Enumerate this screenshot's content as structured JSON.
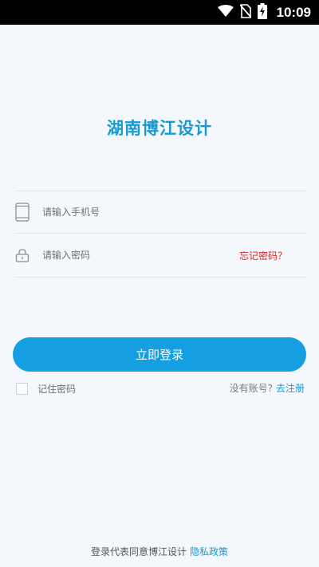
{
  "status_bar": {
    "time": "10:09",
    "icons": [
      "wifi-icon",
      "no-sim-icon",
      "battery-charging-icon"
    ]
  },
  "app": {
    "title": "湖南博江设计"
  },
  "form": {
    "phone": {
      "placeholder": "请输入手机号",
      "value": "",
      "icon": "phone-icon"
    },
    "password": {
      "placeholder": "请输入密码",
      "value": "",
      "icon": "lock-icon"
    },
    "forgot_label": "忘记密码？",
    "login_label": "立即登录",
    "remember_label": "记住密码",
    "remember_checked": false,
    "no_account_label": "没有账号?",
    "register_label": "去注册"
  },
  "footer": {
    "agreement_text": "登录代表同意博江设计",
    "privacy_label": "隐私政策"
  },
  "colors": {
    "accent": "#169ad4",
    "button": "#169ee3",
    "forgot": "#e02020",
    "background": "#f4f8fd"
  }
}
